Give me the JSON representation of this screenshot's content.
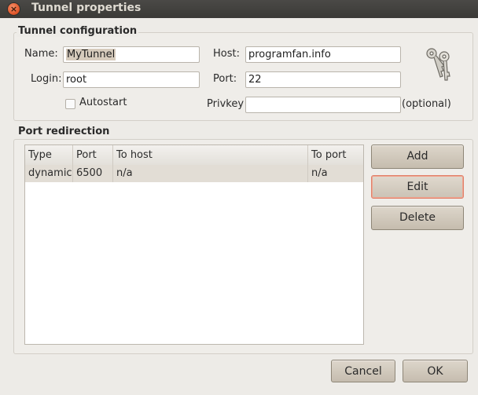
{
  "window": {
    "title": "Tunnel properties",
    "close_glyph": "×"
  },
  "tunnel_config": {
    "legend": "Tunnel configuration",
    "name_label": "Name:",
    "name_value": "MyTunnel",
    "host_label": "Host:",
    "host_value": "programfan.info",
    "login_label": "Login:",
    "login_value": "root",
    "port_label": "Port:",
    "port_value": "22",
    "autostart_label": "Autostart",
    "autostart_checked": false,
    "privkey_label": "Privkey",
    "privkey_value": "",
    "optional_label": "(optional)",
    "icon": "keys-icon"
  },
  "port_redirection": {
    "legend": "Port redirection",
    "columns": [
      "Type",
      "Port",
      "To host",
      "To port"
    ],
    "rows": [
      {
        "type": "dynamic",
        "port": "6500",
        "to_host": "n/a",
        "to_port": "n/a"
      }
    ],
    "buttons": {
      "add": "Add",
      "edit": "Edit",
      "delete": "Delete"
    }
  },
  "footer": {
    "cancel": "Cancel",
    "ok": "OK"
  },
  "colors": {
    "accent": "#e0816a",
    "selected_row": "#e2ddd5",
    "titlebar": "#3c3b37"
  }
}
